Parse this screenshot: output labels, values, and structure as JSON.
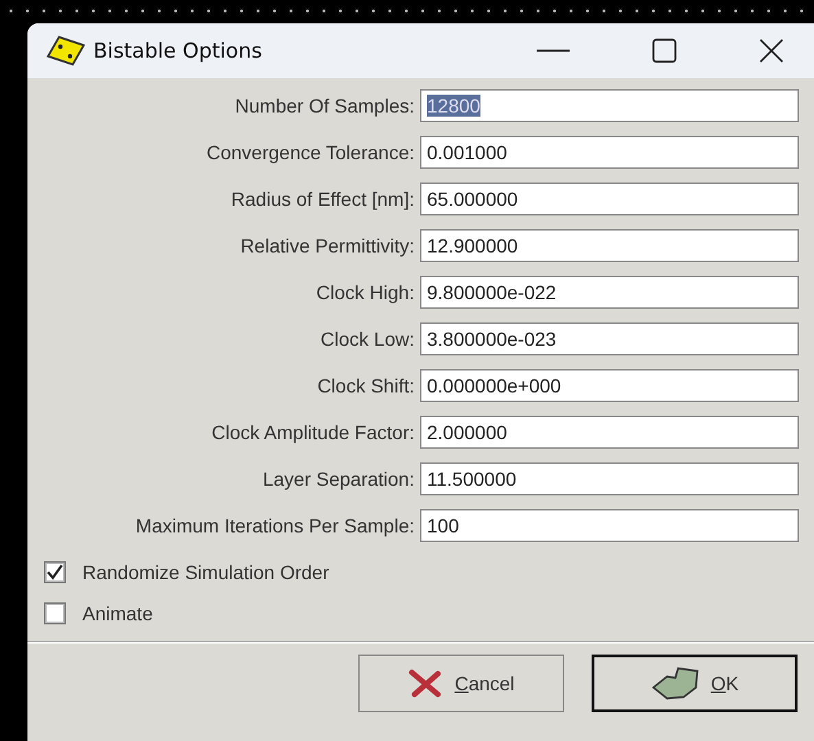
{
  "window": {
    "title": "Bistable Options"
  },
  "fields": [
    {
      "label": "Number Of Samples:",
      "value": "12800",
      "highlighted": true
    },
    {
      "label": "Convergence Tolerance:",
      "value": "0.001000",
      "highlighted": false
    },
    {
      "label": "Radius of Effect [nm]:",
      "value": "65.000000",
      "highlighted": false
    },
    {
      "label": "Relative Permittivity:",
      "value": "12.900000",
      "highlighted": false
    },
    {
      "label": "Clock High:",
      "value": "9.800000e-022",
      "highlighted": false
    },
    {
      "label": "Clock Low:",
      "value": "3.800000e-023",
      "highlighted": false
    },
    {
      "label": "Clock Shift:",
      "value": "0.000000e+000",
      "highlighted": false
    },
    {
      "label": "Clock Amplitude Factor:",
      "value": "2.000000",
      "highlighted": false
    },
    {
      "label": "Layer Separation:",
      "value": "11.500000",
      "highlighted": false
    },
    {
      "label": "Maximum Iterations Per Sample:",
      "value": "100",
      "highlighted": false
    }
  ],
  "checkboxes": [
    {
      "label": "Randomize Simulation Order",
      "checked": true
    },
    {
      "label": "Animate",
      "checked": false
    }
  ],
  "buttons": [
    {
      "kind": "cancel",
      "label": "Cancel",
      "default": false
    },
    {
      "kind": "ok",
      "label": "OK",
      "default": true
    }
  ]
}
